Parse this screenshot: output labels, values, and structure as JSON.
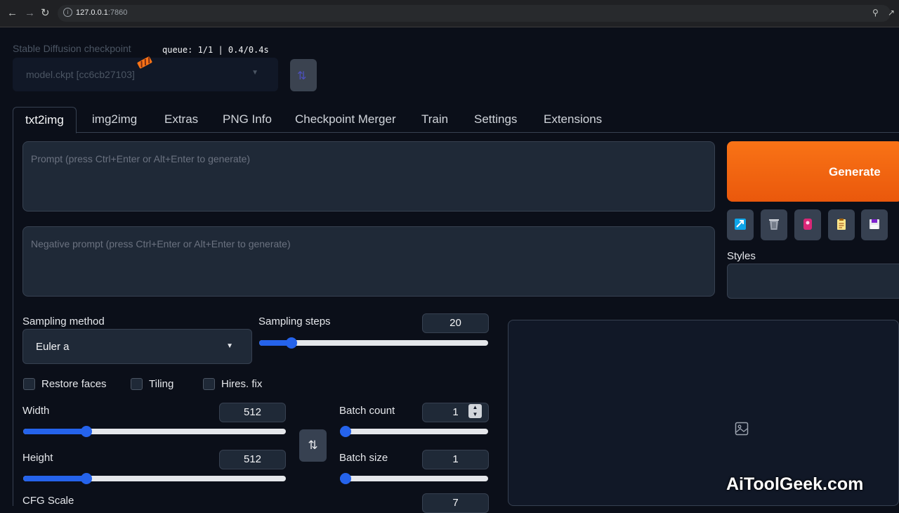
{
  "browser": {
    "url_host": "127.0.0.1",
    "url_port": ":7860"
  },
  "checkpoint": {
    "label": "Stable Diffusion checkpoint",
    "value": "model.ckpt [cc6cb27103]",
    "queue": "queue: 1/1 | 0.4/0.4s"
  },
  "tabs": [
    {
      "label": "txt2img",
      "active": true
    },
    {
      "label": "img2img"
    },
    {
      "label": "Extras"
    },
    {
      "label": "PNG Info"
    },
    {
      "label": "Checkpoint Merger"
    },
    {
      "label": "Train"
    },
    {
      "label": "Settings"
    },
    {
      "label": "Extensions"
    }
  ],
  "prompt": {
    "placeholder": "Prompt (press Ctrl+Enter or Alt+Enter to generate)"
  },
  "negative_prompt": {
    "placeholder": "Negative prompt (press Ctrl+Enter or Alt+Enter to generate)"
  },
  "actions": {
    "generate_label": "Generate",
    "tool_icons": [
      "arrow-check-icon",
      "trash-icon",
      "pink-badge-icon",
      "clipboard-icon",
      "save-icon"
    ],
    "styles_label": "Styles"
  },
  "sampling": {
    "method_label": "Sampling method",
    "method_value": "Euler a",
    "steps_label": "Sampling steps",
    "steps_value": "20",
    "steps_fraction": 0.14
  },
  "options": {
    "restore_faces": "Restore faces",
    "tiling": "Tiling",
    "hires_fix": "Hires. fix"
  },
  "size": {
    "width_label": "Width",
    "width_value": "512",
    "width_fraction": 0.24,
    "height_label": "Height",
    "height_value": "512",
    "height_fraction": 0.24
  },
  "batch": {
    "count_label": "Batch count",
    "count_value": "1",
    "count_fraction": 0.0,
    "size_label": "Batch size",
    "size_value": "1",
    "size_fraction": 0.0
  },
  "cfg": {
    "label": "CFG Scale",
    "value": "7"
  },
  "watermark": "AiToolGeek.com",
  "colors": {
    "accent": "#2563eb",
    "generate": "#f97316",
    "background": "#0b0f19"
  }
}
